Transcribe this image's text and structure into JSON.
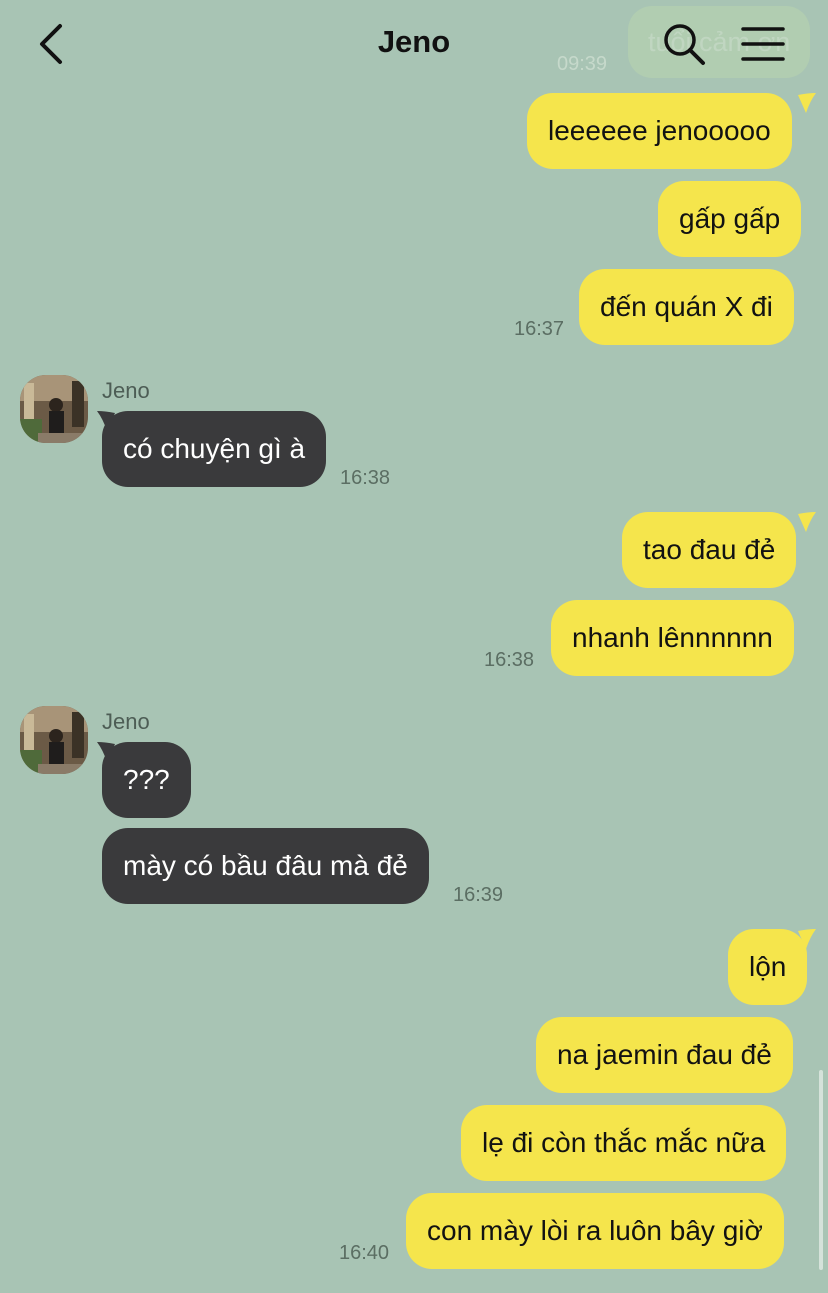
{
  "header": {
    "title": "Jeno",
    "ghost_text": "tuổi cảm ơn",
    "ghost_time": "09:39",
    "icons": [
      "chevron-left-icon",
      "search-icon",
      "menu-icon"
    ]
  },
  "colors": {
    "background": "#a8c4b4",
    "outgoing": "#f5e54c",
    "incoming": "#3a3a3c"
  },
  "messages": [
    {
      "text": "leeeeee jenooooo"
    },
    {
      "text": "gấp gấp"
    },
    {
      "text": "đến quán X đi",
      "time": "16:37"
    },
    {
      "sender": "Jeno",
      "text": "có chuyện gì à",
      "time": "16:38"
    },
    {
      "text": "tao đau đẻ"
    },
    {
      "text": "nhanh lênnnnnn",
      "time": "16:38"
    },
    {
      "sender": "Jeno",
      "text": "???"
    },
    {
      "text": "mày có bầu đâu mà đẻ",
      "time": "16:39"
    },
    {
      "text": "lộn"
    },
    {
      "text": "na jaemin đau đẻ"
    },
    {
      "text": "lẹ đi còn thắc mắc nữa"
    },
    {
      "text": "con mày lòi ra luôn bây giờ",
      "time": "16:40"
    }
  ]
}
